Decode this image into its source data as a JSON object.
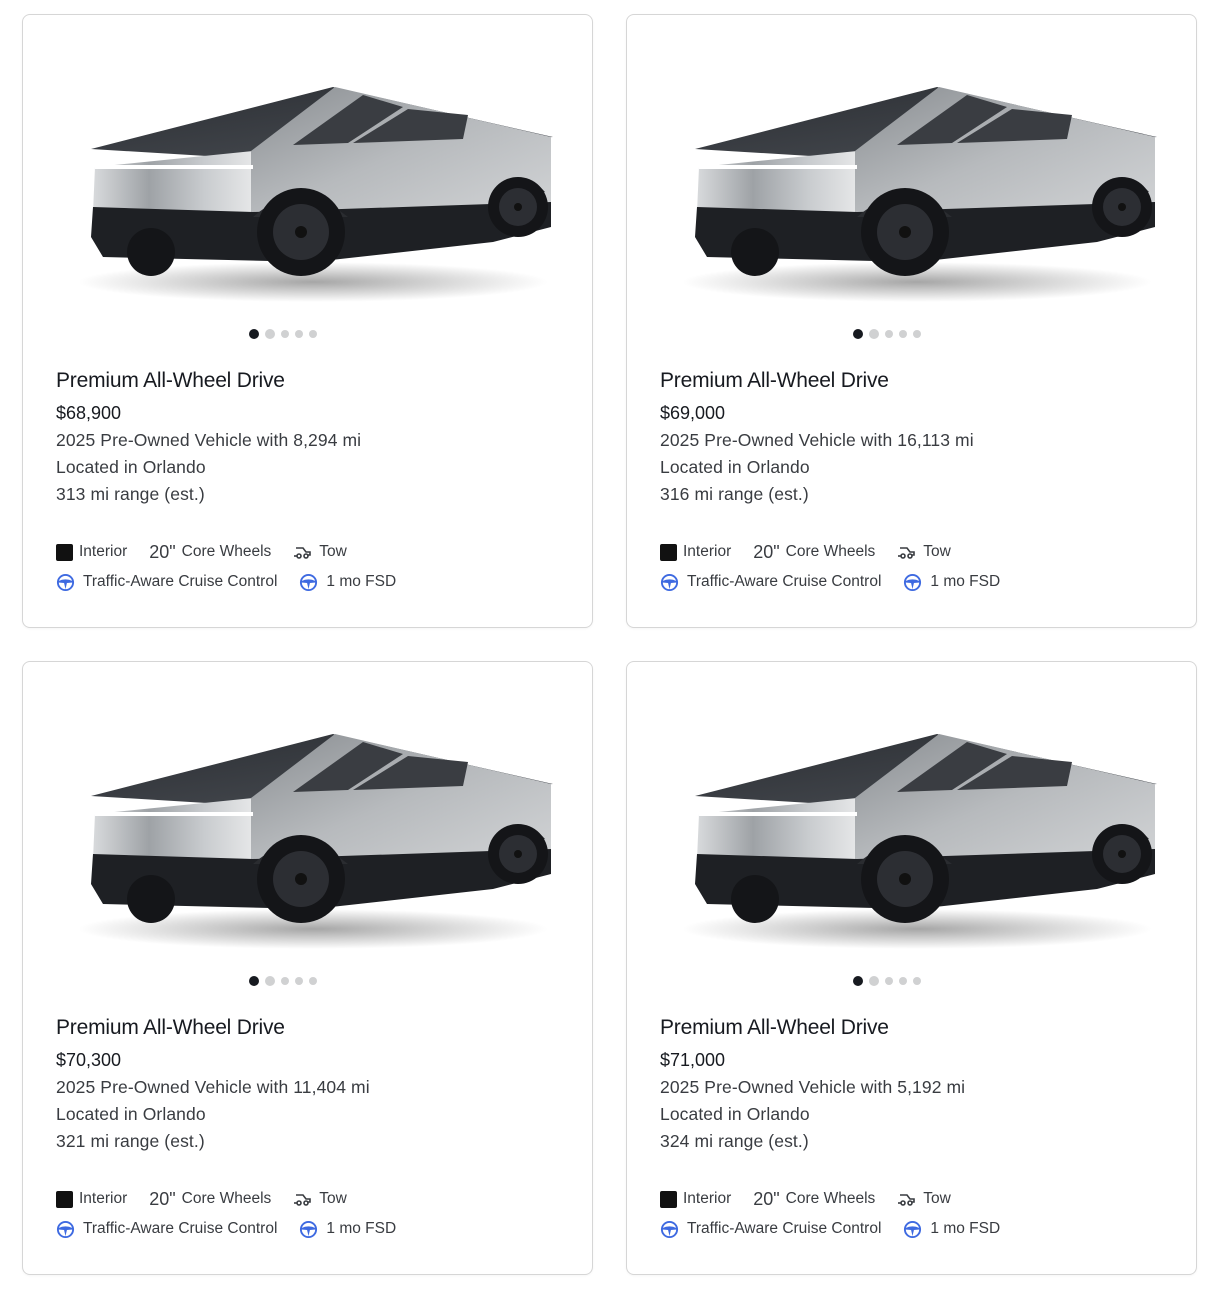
{
  "listings": [
    {
      "title": "Premium All-Wheel Drive",
      "price": "$68,900",
      "vehicle": "2025 Pre-Owned Vehicle with 8,294 mi",
      "location": "Located in Orlando",
      "range": "313 mi range (est.)",
      "features": {
        "interior": "Interior",
        "wheels_size": "20\"",
        "wheels": "Core Wheels",
        "tow": "Tow",
        "cruise": "Traffic-Aware Cruise Control",
        "fsd": "1 mo FSD"
      },
      "gallery_dots": 5,
      "active_dot": 1
    },
    {
      "title": "Premium All-Wheel Drive",
      "price": "$69,000",
      "vehicle": "2025 Pre-Owned Vehicle with 16,113 mi",
      "location": "Located in Orlando",
      "range": "316 mi range (est.)",
      "features": {
        "interior": "Interior",
        "wheels_size": "20\"",
        "wheels": "Core Wheels",
        "tow": "Tow",
        "cruise": "Traffic-Aware Cruise Control",
        "fsd": "1 mo FSD"
      },
      "gallery_dots": 5,
      "active_dot": 1
    },
    {
      "title": "Premium All-Wheel Drive",
      "price": "$70,300",
      "vehicle": "2025 Pre-Owned Vehicle with 11,404 mi",
      "location": "Located in Orlando",
      "range": "321 mi range (est.)",
      "features": {
        "interior": "Interior",
        "wheels_size": "20\"",
        "wheels": "Core Wheels",
        "tow": "Tow",
        "cruise": "Traffic-Aware Cruise Control",
        "fsd": "1 mo FSD"
      },
      "gallery_dots": 5,
      "active_dot": 1
    },
    {
      "title": "Premium All-Wheel Drive",
      "price": "$71,000",
      "vehicle": "2025 Pre-Owned Vehicle with 5,192 mi",
      "location": "Located in Orlando",
      "range": "324 mi range (est.)",
      "features": {
        "interior": "Interior",
        "wheels_size": "20\"",
        "wheels": "Core Wheels",
        "tow": "Tow",
        "cruise": "Traffic-Aware Cruise Control",
        "fsd": "1 mo FSD"
      },
      "gallery_dots": 5,
      "active_dot": 1
    }
  ],
  "colors": {
    "accent_icon": "#3e6ae1",
    "text_primary": "#171a20",
    "text_secondary": "#393c41",
    "interior_swatch": "#111111"
  },
  "icons": {
    "car_image": "cybertruck-image",
    "interior": "interior-swatch-icon",
    "tow": "tow-icon",
    "cruise": "steering-wheel-icon",
    "fsd": "steering-wheel-icon"
  }
}
